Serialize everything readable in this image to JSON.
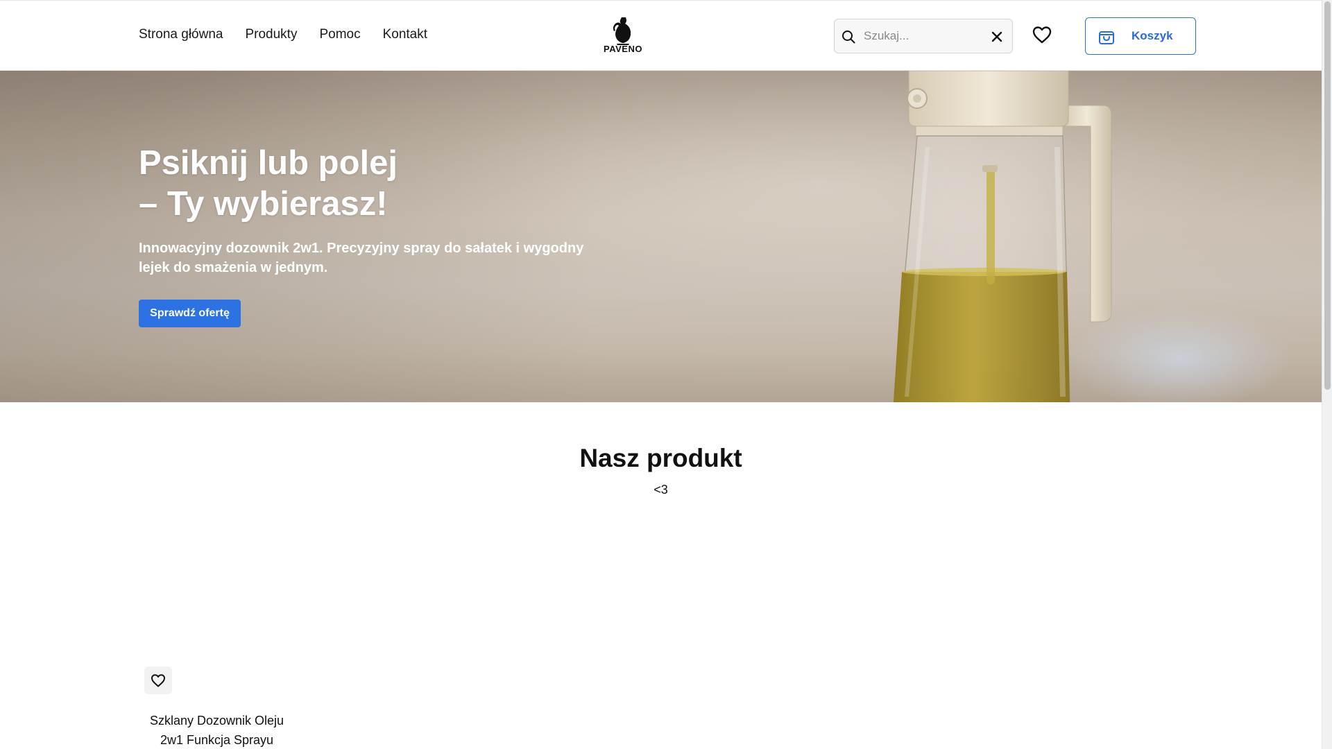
{
  "header": {
    "nav": [
      {
        "label": "Strona główna"
      },
      {
        "label": "Produkty"
      },
      {
        "label": "Pomoc"
      },
      {
        "label": "Kontakt"
      }
    ],
    "logo_text": "PAVENO",
    "search": {
      "placeholder": "Szukaj...",
      "value": ""
    },
    "cart_label": "Koszyk",
    "icons": {
      "search": "search-icon",
      "clear": "close-icon",
      "wishlist": "heart-icon",
      "cart": "shopping-bag-icon"
    }
  },
  "hero": {
    "title_line1": "Psiknij lub polej",
    "title_line2": "– Ty wybierasz!",
    "subtitle": "Innowacyjny dozownik 2w1. Precyzyjny spray do sałatek i wygodny lejek do smażenia w jednym.",
    "cta_label": "Sprawdź ofertę"
  },
  "products_section": {
    "title": "Nasz produkt",
    "subtitle": "<3",
    "products": [
      {
        "name_line1": "Szklany Dozownik Oleju",
        "name_line2": "2w1 Funkcja Sprayu",
        "wishlist_icon": "heart-icon"
      }
    ]
  },
  "colors": {
    "accent": "#2d72e3",
    "cart_border": "#2f6fd6",
    "text": "#111111"
  }
}
